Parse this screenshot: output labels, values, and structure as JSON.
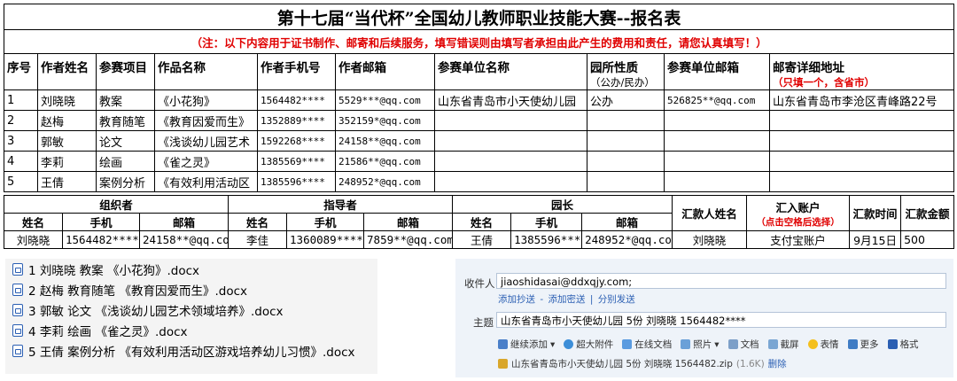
{
  "title": "第十七届“当代杯”全国幼儿教师职业技能大赛--报名表",
  "note": "（注：以下内容用于证书制作、邮寄和后续服务，填写错误则由填写者承担由此产生的费用和责任，请您认真填写！）",
  "headers": {
    "no": "序号",
    "author": "作者姓名",
    "project": "参赛项目",
    "work": "作品名称",
    "phone": "作者手机号",
    "email": "作者邮箱",
    "unit": "参赛单位名称",
    "nature": "园所性质",
    "nature_sub": "（公办/民办）",
    "unit_email": "参赛单位邮箱",
    "address": "邮寄详细地址",
    "address_sub": "（只填一个，含省市）"
  },
  "rows": [
    {
      "no": "1",
      "author": "刘晓晓",
      "project": "教案",
      "work": "《小花狗》",
      "phone": "1564482****",
      "email": "5529***@qq.com",
      "unit": "山东省青岛市小天使幼儿园",
      "nature": "公办",
      "unit_email": "526825**@qq.com",
      "address": "山东省青岛市李沧区青峰路22号"
    },
    {
      "no": "2",
      "author": "赵梅",
      "project": "教育随笔",
      "work": "《教育因爱而生》",
      "phone": "1352889****",
      "email": "352159*@qq.com",
      "unit": "",
      "nature": "",
      "unit_email": "",
      "address": ""
    },
    {
      "no": "3",
      "author": "郭敏",
      "project": "论文",
      "work": "《浅谈幼儿园艺术",
      "phone": "1592268****",
      "email": "24158**@qq.com",
      "unit": "",
      "nature": "",
      "unit_email": "",
      "address": ""
    },
    {
      "no": "4",
      "author": "李莉",
      "project": "绘画",
      "work": "《雀之灵》",
      "phone": "1385569****",
      "email": "21586**@qq.com",
      "unit": "",
      "nature": "",
      "unit_email": "",
      "address": ""
    },
    {
      "no": "5",
      "author": "王倩",
      "project": "案例分析",
      "work": "《有效利用活动区",
      "phone": "1385596****",
      "email": "248952*@qq.com",
      "unit": "",
      "nature": "",
      "unit_email": "",
      "address": ""
    }
  ],
  "contacts": {
    "organizer": "组织者",
    "instructor": "指导者",
    "principal": "园长",
    "name": "姓名",
    "phone": "手机",
    "email": "邮箱",
    "remitter": "汇款人姓名",
    "account": "汇入账户",
    "account_sub": "（点击空格后选择）",
    "time": "汇款时间",
    "amount": "汇款金额",
    "values": {
      "org_name": "刘晓晓",
      "org_phone": "1564482****",
      "org_email": "24158**@qq.com",
      "ins_name": "李佳",
      "ins_phone": "1360089****",
      "ins_email": "7859**@qq.com",
      "pri_name": "王倩",
      "pri_phone": "1385596****",
      "pri_email": "248952*@qq.com",
      "remitter": "刘晓晓",
      "account": "支付宝账户",
      "time": "9月15日",
      "amount": "500"
    }
  },
  "files": [
    "1 刘晓晓 教案 《小花狗》.docx",
    "2 赵梅 教育随笔 《教育因爱而生》.docx",
    "3 郭敏 论文 《浅谈幼儿园艺术领域培养》.docx",
    "4 李莉 绘画 《雀之灵》.docx",
    "5 王倩 案例分析 《有效利用活动区游戏培养幼儿习惯》.docx"
  ],
  "mail": {
    "to_label": "收件人",
    "to_value": "jiaoshidasai@ddxqjy.com;",
    "cc_links": [
      "添加抄送",
      "-",
      "添加密送",
      "|",
      "分别发送"
    ],
    "subject_label": "主题",
    "subject_value": "山东省青岛市小天使幼儿园 5份 刘晓晓 1564482****",
    "toolbar": [
      "继续添加",
      "超大附件",
      "在线文档",
      "照片",
      "文档",
      "截屏",
      "表情",
      "更多",
      "格式"
    ],
    "attachment": "山东省青岛市小天使幼儿园 5份 刘晓晓 1564482.zip",
    "attachment_size": "(1.6K)",
    "attachment_delete": "删除"
  }
}
